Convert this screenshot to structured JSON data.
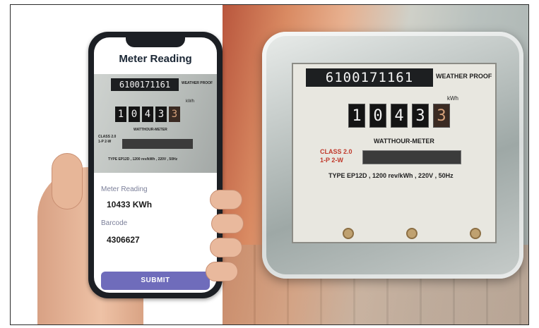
{
  "phone": {
    "title": "Meter Reading",
    "scan_preview": {
      "serial": "6100171161",
      "weather_proof": "WEATHER PROOF",
      "kwh_label": "kWh",
      "digits": [
        "1",
        "0",
        "4",
        "3",
        "3"
      ],
      "meter_name": "WATTHOUR-METER",
      "class_text": "CLASS 2.0\n1-P 2-W",
      "type_text": "TYPE EP12D , 1200 rev/kWh , 220V , 50Hz"
    },
    "fields": [
      {
        "label": "Meter Reading",
        "value": "10433 KWh"
      },
      {
        "label": "Barcode",
        "value": "4306627"
      }
    ],
    "submit_label": "SUBMIT",
    "accent_color": "#6f6cbb"
  },
  "meter_photo": {
    "serial": "6100171161",
    "weather_proof": "WEATHER PROOF",
    "kwh_label": "kWh",
    "digits": [
      "1",
      "0",
      "4",
      "3",
      "3"
    ],
    "meter_name": "WATTHOUR-METER",
    "class_line1": "CLASS 2.0",
    "class_line2": "1-P 2-W",
    "type_text": "TYPE EP12D , 1200 rev/kWh , 220V , 50Hz"
  }
}
